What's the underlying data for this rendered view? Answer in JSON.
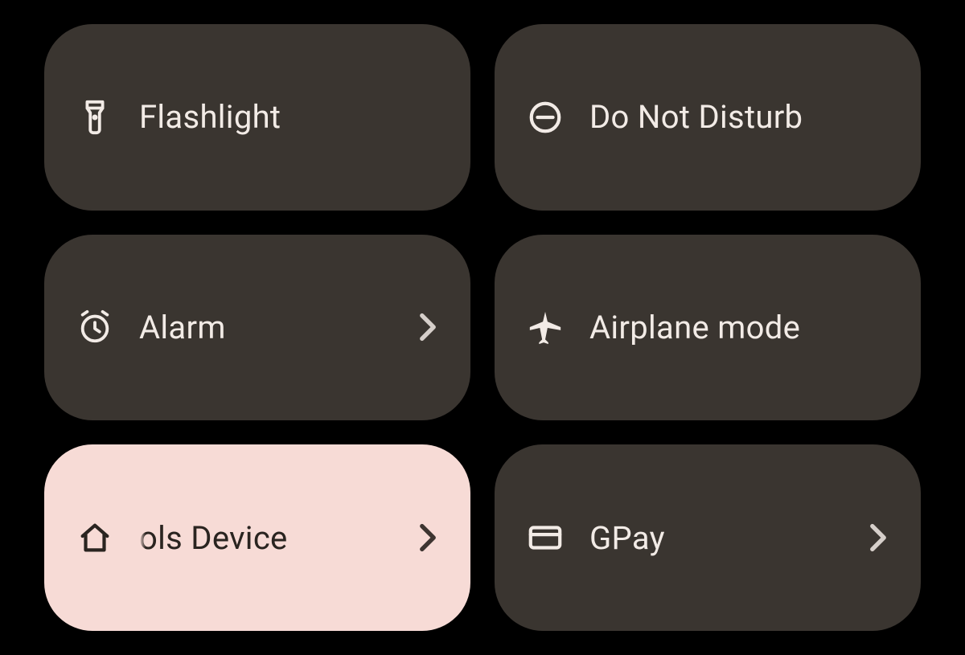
{
  "tiles": [
    {
      "id": "flashlight",
      "label": "Flashlight",
      "icon": "flashlight-icon",
      "chevron": false,
      "active": false
    },
    {
      "id": "dnd",
      "label": "Do Not Disturb",
      "icon": "dnd-icon",
      "chevron": false,
      "active": false
    },
    {
      "id": "alarm",
      "label": "Alarm",
      "icon": "alarm-icon",
      "chevron": true,
      "active": false
    },
    {
      "id": "airplane",
      "label": "Airplane mode",
      "icon": "airplane-icon",
      "chevron": false,
      "active": false
    },
    {
      "id": "device",
      "label": "ols        Device",
      "icon": "home-icon",
      "chevron": true,
      "active": true
    },
    {
      "id": "gpay",
      "label": "GPay",
      "icon": "card-icon",
      "chevron": true,
      "active": false
    }
  ],
  "colors": {
    "tile_bg": "#3a3530",
    "tile_fg": "#f2ebe6",
    "active_bg": "#f7dbd6",
    "active_fg": "#2a2420",
    "page_bg": "#000000"
  }
}
